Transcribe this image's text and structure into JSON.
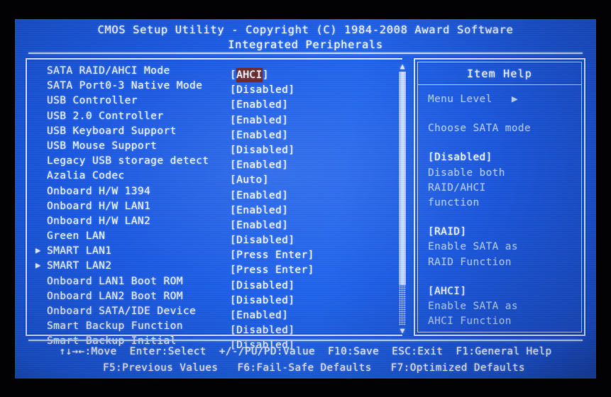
{
  "window": {
    "title_line1": "CMOS Setup Utility - Copyright (C) 1984-2008 Award Software",
    "title_line2": "Integrated Peripherals"
  },
  "colors": {
    "screen_background": "#1b5ae4",
    "text": "#eef3ff",
    "dim_text": "#aac4ea",
    "border": "#d4e3ff",
    "selection_highlight": "#6f2222",
    "scrollbar_thumb": "#dceaff"
  },
  "settings": {
    "rows": [
      {
        "label": "SATA RAID/AHCI Mode",
        "value_open": "[",
        "value_text": "AHCI",
        "value_close": "]",
        "selected": true,
        "submenu": false
      },
      {
        "label": "SATA Port0-3 Native Mode",
        "value_open": "[",
        "value_text": "Disabled",
        "value_close": "]",
        "selected": false,
        "submenu": false
      },
      {
        "label": "USB Controller",
        "value_open": "[",
        "value_text": "Enabled",
        "value_close": "]",
        "selected": false,
        "submenu": false
      },
      {
        "label": "USB 2.0 Controller",
        "value_open": "[",
        "value_text": "Enabled",
        "value_close": "]",
        "selected": false,
        "submenu": false
      },
      {
        "label": "USB Keyboard Support",
        "value_open": "[",
        "value_text": "Enabled",
        "value_close": "]",
        "selected": false,
        "submenu": false
      },
      {
        "label": "USB Mouse Support",
        "value_open": "[",
        "value_text": "Disabled",
        "value_close": "]",
        "selected": false,
        "submenu": false
      },
      {
        "label": "Legacy USB storage detect",
        "value_open": "[",
        "value_text": "Enabled",
        "value_close": "]",
        "selected": false,
        "submenu": false
      },
      {
        "label": "Azalia Codec",
        "value_open": "[",
        "value_text": "Auto",
        "value_close": "]",
        "selected": false,
        "submenu": false
      },
      {
        "label": "Onboard H/W 1394",
        "value_open": "[",
        "value_text": "Enabled",
        "value_close": "]",
        "selected": false,
        "submenu": false
      },
      {
        "label": "Onboard H/W LAN1",
        "value_open": "[",
        "value_text": "Enabled",
        "value_close": "]",
        "selected": false,
        "submenu": false
      },
      {
        "label": "Onboard H/W LAN2",
        "value_open": "[",
        "value_text": "Enabled",
        "value_close": "]",
        "selected": false,
        "submenu": false
      },
      {
        "label": "Green LAN",
        "value_open": "[",
        "value_text": "Disabled",
        "value_close": "]",
        "selected": false,
        "submenu": false
      },
      {
        "label": "SMART LAN1",
        "value_open": "[",
        "value_text": "Press Enter",
        "value_close": "]",
        "selected": false,
        "submenu": true
      },
      {
        "label": "SMART LAN2",
        "value_open": "[",
        "value_text": "Press Enter",
        "value_close": "]",
        "selected": false,
        "submenu": true
      },
      {
        "label": "Onboard LAN1 Boot ROM",
        "value_open": "[",
        "value_text": "Disabled",
        "value_close": "]",
        "selected": false,
        "submenu": false
      },
      {
        "label": "Onboard LAN2 Boot ROM",
        "value_open": "[",
        "value_text": "Disabled",
        "value_close": "]",
        "selected": false,
        "submenu": false
      },
      {
        "label": "Onboard SATA/IDE Device",
        "value_open": "[",
        "value_text": "Enabled",
        "value_close": "]",
        "selected": false,
        "submenu": false
      },
      {
        "label": "Smart Backup Function",
        "value_open": "[",
        "value_text": "Disabled",
        "value_close": "]",
        "selected": false,
        "submenu": false
      },
      {
        "label": "Smart Backup Initial",
        "value_open": "[",
        "value_text": "Disabled",
        "value_close": "]",
        "selected": false,
        "submenu": false
      }
    ],
    "submenu_marker": "▶",
    "scrollbar": {
      "up_arrow": "▲",
      "down_arrow": "▼",
      "thumb_percent": 84
    }
  },
  "item_help": {
    "title": "Item Help",
    "menu_level_label": "Menu Level",
    "menu_level_arrow": "▶",
    "description": "Choose SATA mode",
    "options": [
      {
        "name": "[Disabled]",
        "detail_lines": [
          "Disable both",
          "RAID/AHCI",
          "function"
        ]
      },
      {
        "name": "[RAID]",
        "detail_lines": [
          "Enable SATA as",
          "RAID Function"
        ]
      },
      {
        "name": "[AHCI]",
        "detail_lines": [
          "Enable SATA as",
          "AHCI Function"
        ]
      }
    ]
  },
  "footer": {
    "line1": "↑↓→←:Move  Enter:Select  +/-/PU/PD:Value  F10:Save  ESC:Exit  F1:General Help",
    "line2": "F5:Previous Values   F6:Fail-Safe Defaults   F7:Optimized Defaults",
    "keys": [
      {
        "key": "↑↓→←",
        "action": "Move"
      },
      {
        "key": "Enter",
        "action": "Select"
      },
      {
        "key": "+/-/PU/PD",
        "action": "Value"
      },
      {
        "key": "F10",
        "action": "Save"
      },
      {
        "key": "ESC",
        "action": "Exit"
      },
      {
        "key": "F1",
        "action": "General Help"
      },
      {
        "key": "F5",
        "action": "Previous Values"
      },
      {
        "key": "F6",
        "action": "Fail-Safe Defaults"
      },
      {
        "key": "F7",
        "action": "Optimized Defaults"
      }
    ]
  }
}
